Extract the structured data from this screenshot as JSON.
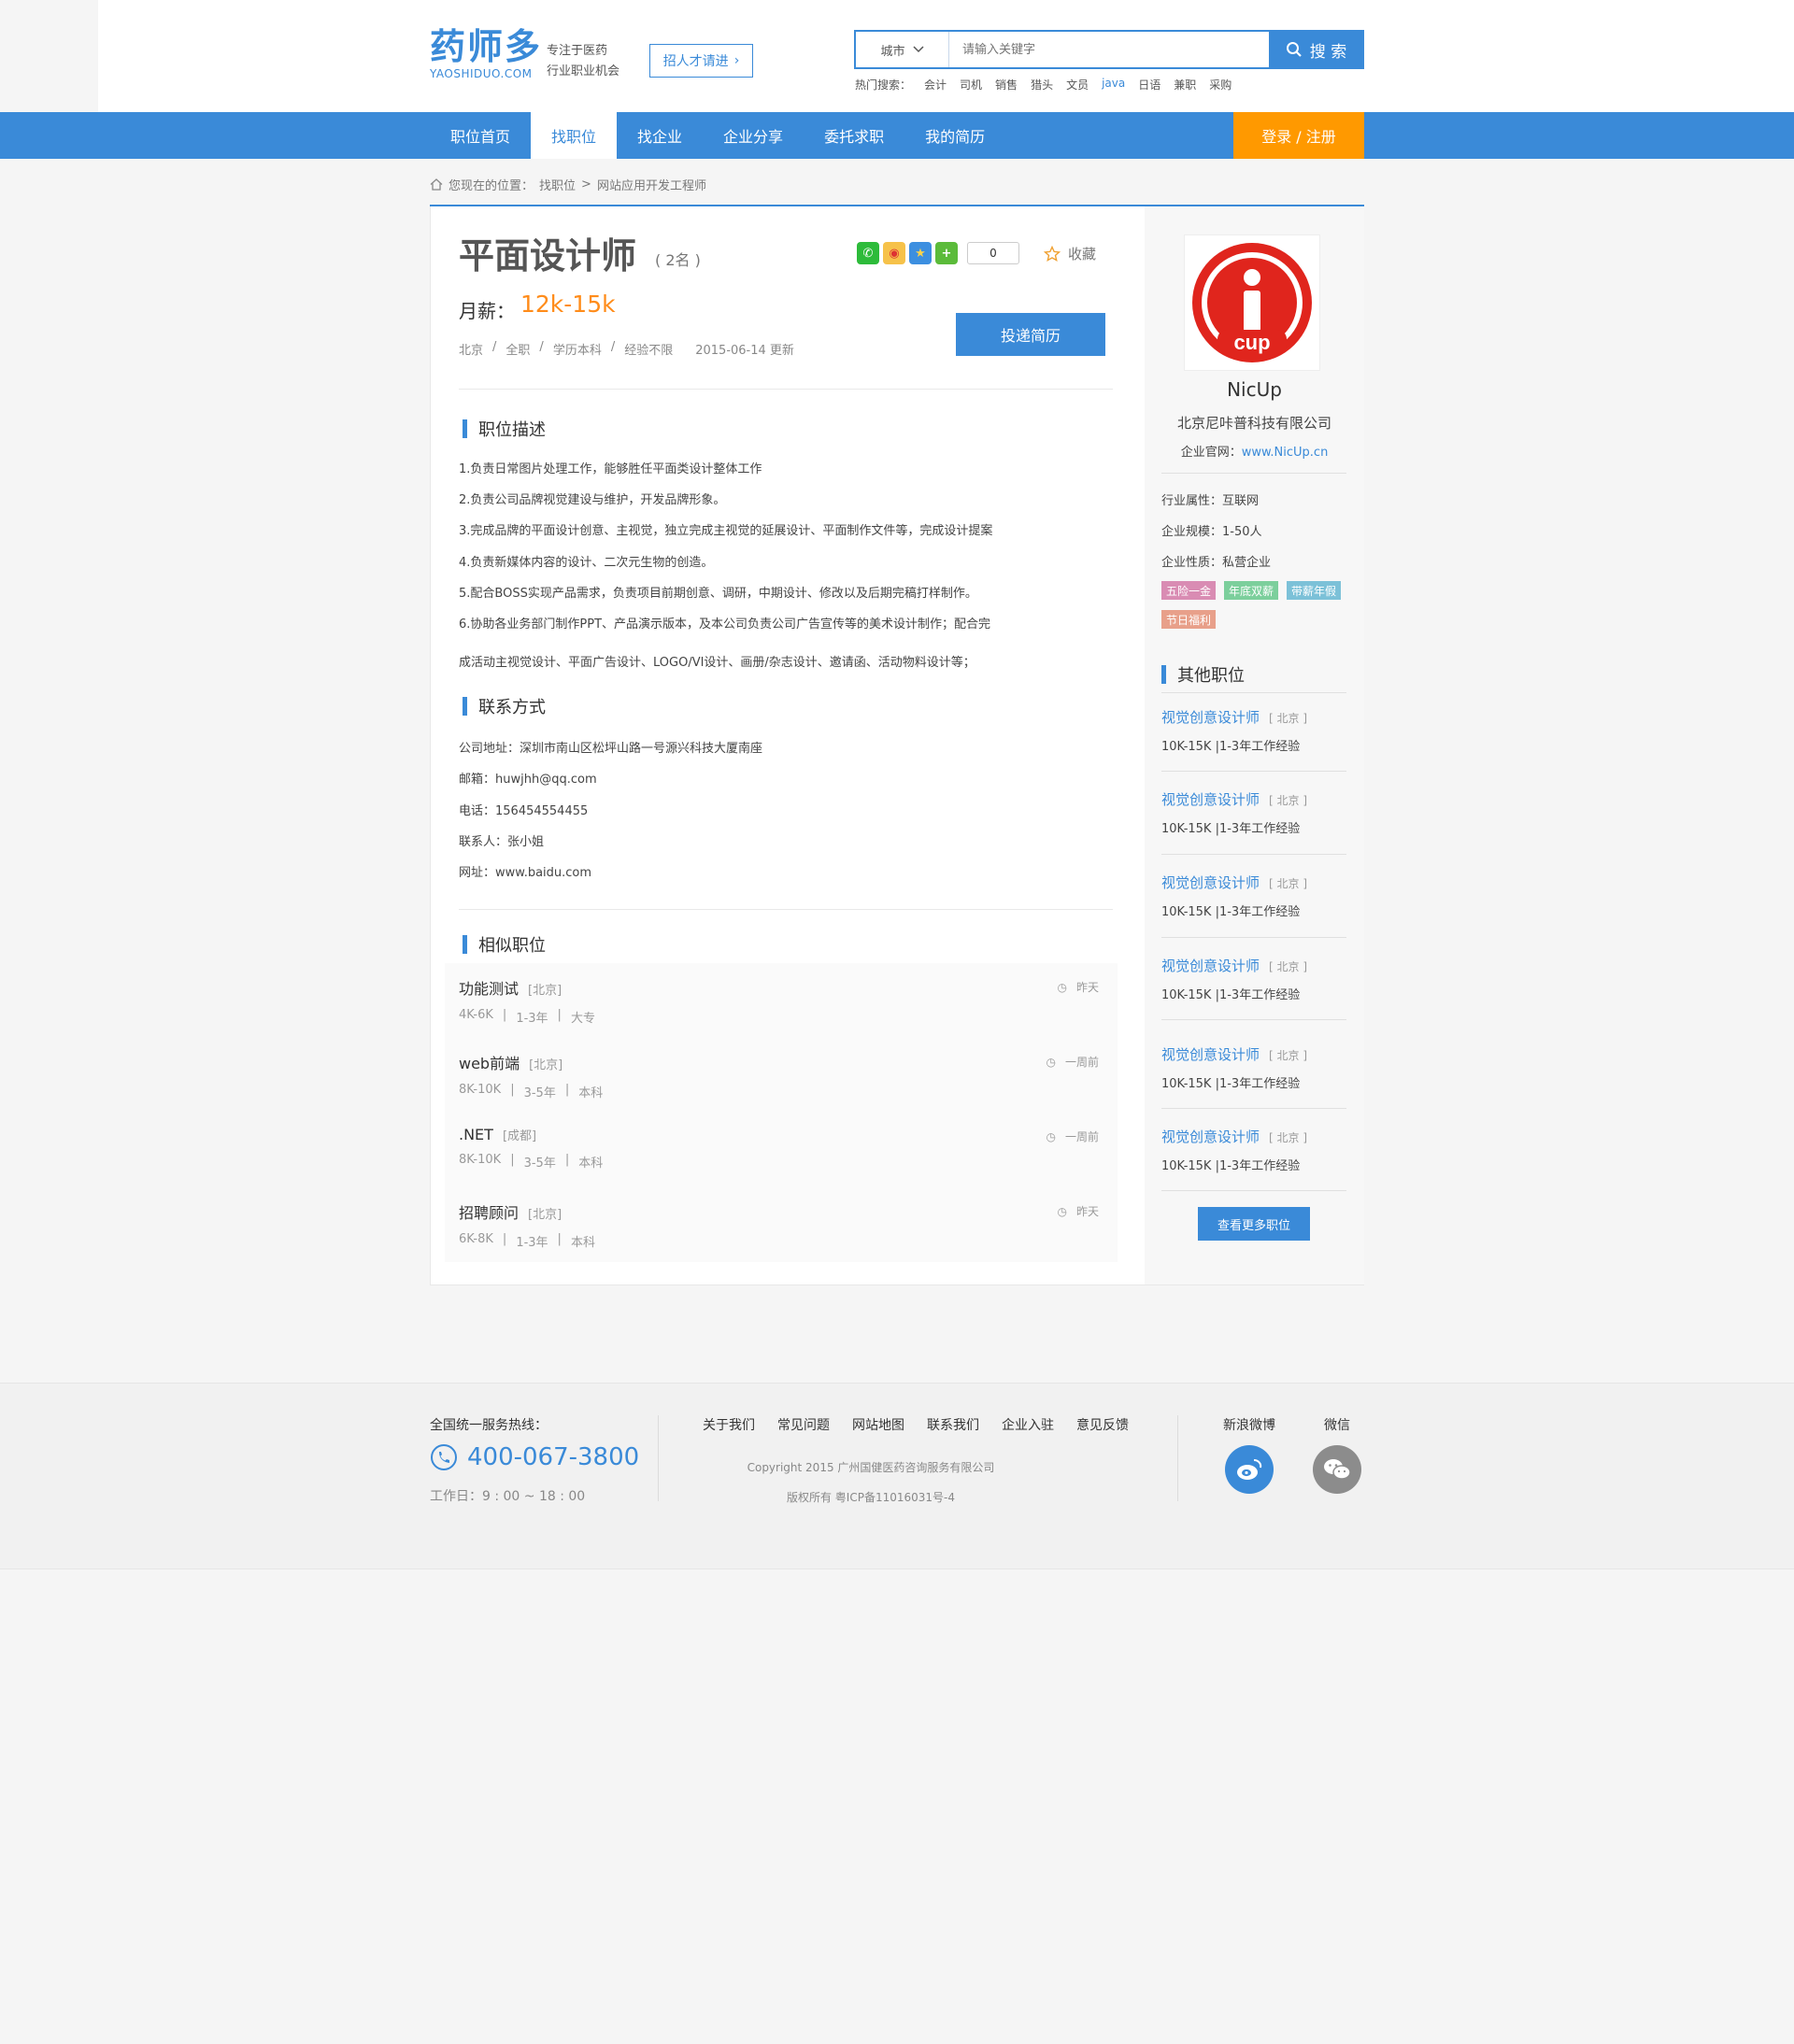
{
  "header": {
    "logo_cn": "药师多",
    "logo_en": "YAOSHIDUO.COM",
    "slogan_line1": "专注于医药",
    "slogan_line2": "行业职业机会",
    "recruit_button": "招人才请进",
    "city_select": "城市",
    "search_placeholder": "请输入关键字",
    "search_button": "搜 索",
    "hot_label": "热门搜索：",
    "hot_terms": [
      "会计",
      "司机",
      "销售",
      "猎头",
      "文员",
      "java",
      "日语",
      "兼职",
      "采购"
    ]
  },
  "nav": {
    "items": [
      "职位首页",
      "找职位",
      "找企业",
      "企业分享",
      "委托求职",
      "我的简历"
    ],
    "active_index": 1,
    "login": "登录 / 注册"
  },
  "breadcrumb": {
    "label": "您现在的位置：",
    "level1": "找职位",
    "separator": ">",
    "level2": "网站应用开发工程师"
  },
  "job": {
    "title": "平面设计师",
    "count": "( 2名 )",
    "salary_label": "月薪：",
    "salary": "12k-15k",
    "meta": [
      "北京",
      "/",
      "全职",
      "/",
      "学历本科",
      "/",
      "经验不限"
    ],
    "date": "2015-06-14  更新",
    "share_count": "0",
    "favorite": "收藏",
    "apply_button": "投递简历"
  },
  "description": {
    "heading": "职位描述",
    "lines": [
      "1.负责日常图片处理工作，能够胜任平面类设计整体工作",
      "2.负责公司品牌视觉建设与维护，开发品牌形象。",
      "3.完成品牌的平面设计创意、主视觉，独立完成主视觉的延展设计、平面制作文件等，完成设计提案",
      "4.负责新媒体内容的设计、二次元生物的创造。",
      "5.配合BOSS实现产品需求，负责项目前期创意、调研，中期设计、修改以及后期完稿打样制作。",
      "6.协助各业务部门制作PPT、产品演示版本，及本公司负责公司广告宣传等的美术设计制作；配合完",
      "成活动主视觉设计、平面广告设计、LOGO/VI设计、画册/杂志设计、邀请函、活动物料设计等；"
    ]
  },
  "contact": {
    "heading": "联系方式",
    "lines": [
      "公司地址：深圳市南山区松坪山路一号源兴科技大厦南座",
      "邮箱：huwjhh@qq.com",
      "电话：156454554455",
      "联系人：张小姐",
      "网址：www.baidu.com"
    ]
  },
  "similar": {
    "heading": "相似职位",
    "items": [
      {
        "title": "功能测试",
        "city": "[北京]",
        "salary": "4K-6K",
        "exp": "1-3年",
        "edu": "大专",
        "time": "昨天"
      },
      {
        "title": "web前端",
        "city": "[北京]",
        "salary": "8K-10K",
        "exp": "3-5年",
        "edu": "本科",
        "time": "一周前"
      },
      {
        "title": ".NET",
        "city": "[成都]",
        "salary": "8K-10K",
        "exp": "3-5年",
        "edu": "本科",
        "time": "一周前"
      },
      {
        "title": "招聘顾问",
        "city": "[北京]",
        "salary": "6K-8K",
        "exp": "1-3年",
        "edu": "本科",
        "time": "昨天"
      }
    ],
    "sep": "|"
  },
  "company": {
    "logo_text": "cup",
    "name": "NicUp",
    "full_name": "北京尼咔普科技有限公司",
    "site_label": "企业官网：",
    "site_url": "www.NicUp.cn",
    "industry": "行业属性：互联网",
    "scale": "企业规模：1-50人",
    "nature": "企业性质：私营企业",
    "tags": [
      {
        "text": "五险一金",
        "color": "#d98cb3"
      },
      {
        "text": "年底双薪",
        "color": "#7ccf9c"
      },
      {
        "text": "带薪年假",
        "color": "#7cc1d8"
      },
      {
        "text": "节日福利",
        "color": "#e8a08a"
      }
    ]
  },
  "other_jobs": {
    "heading": "其他职位",
    "items": [
      {
        "title": "视觉创意设计师",
        "city": "[ 北京 ]",
        "sub": "10K-15K |1-3年工作经验"
      },
      {
        "title": "视觉创意设计师",
        "city": "[ 北京 ]",
        "sub": "10K-15K |1-3年工作经验"
      },
      {
        "title": "视觉创意设计师",
        "city": "[ 北京 ]",
        "sub": "10K-15K |1-3年工作经验"
      },
      {
        "title": "视觉创意设计师",
        "city": "[ 北京 ]",
        "sub": "10K-15K |1-3年工作经验"
      },
      {
        "title": "视觉创意设计师",
        "city": "[ 北京 ]",
        "sub": "10K-15K |1-3年工作经验"
      },
      {
        "title": "视觉创意设计师",
        "city": "[ 北京 ]",
        "sub": "10K-15K |1-3年工作经验"
      }
    ],
    "more_button": "查看更多职位"
  },
  "footer": {
    "hotline_label": "全国统一服务热线：",
    "phone": "400-067-3800",
    "hours": "工作日：9 : 00 ~ 18 : 00",
    "links": [
      "关于我们",
      "常见问题",
      "网站地图",
      "联系我们",
      "企业入驻",
      "意见反馈"
    ],
    "copyright": "Copyright  2015 广州国健医药咨询服务有限公司",
    "icp": "版权所有    粤ICP备11016031号-4",
    "weibo": "新浪微博",
    "wechat": "微信"
  },
  "colors": {
    "brand_blue": "#3a8ad8",
    "login_orange": "#ff9900",
    "salary_orange": "#ff8c1a"
  }
}
